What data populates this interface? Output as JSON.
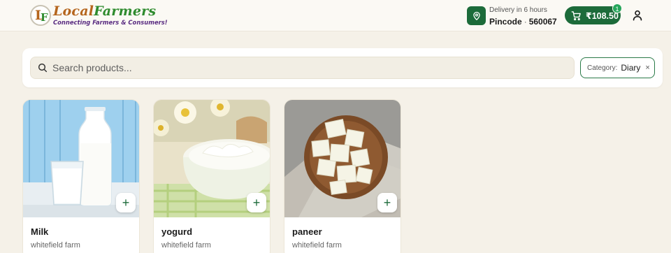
{
  "brand": {
    "logo_letters": [
      "L",
      "F"
    ],
    "name_part1": "Local",
    "name_part2": "Farmers",
    "tagline": "Connecting Farmers & Consumers!",
    "colors": {
      "primary": "#1c6b3a",
      "brown": "#b5651d",
      "green": "#2e8b2e",
      "purple": "#5a2d82"
    }
  },
  "header": {
    "location_icon": "map-pin-icon",
    "delivery_label": "Delivery in 6 hours",
    "pincode_label": "Pincode",
    "pincode_sep": "·",
    "pincode_value": "560067",
    "cart": {
      "icon": "shopping-cart-icon",
      "total": "₹108.50",
      "count": "1"
    },
    "user_icon": "user-icon"
  },
  "search": {
    "placeholder": "Search products...",
    "value": "",
    "filter": {
      "label": "Category:",
      "value": "Diary",
      "close": "×"
    }
  },
  "products": [
    {
      "name": "Milk",
      "farm": "whitefield farm",
      "image": "milk bottle and glass",
      "add": "+"
    },
    {
      "name": "yogurd",
      "farm": "whitefield farm",
      "image": "bowl of yogurt with flowers",
      "add": "+"
    },
    {
      "name": "paneer",
      "farm": "whitefield farm",
      "image": "paneer cubes in wooden bowl",
      "add": "+"
    }
  ]
}
